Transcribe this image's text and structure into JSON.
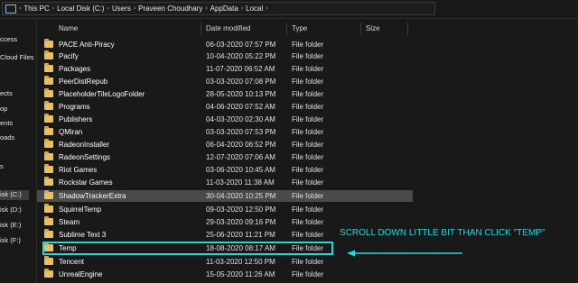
{
  "address": {
    "crumbs": [
      "This PC",
      "Local Disk (C:)",
      "Users",
      "Praveen Choudhary",
      "AppData",
      "Local"
    ]
  },
  "nav": {
    "items": [
      {
        "label": "ccess",
        "selected": false
      },
      {
        "label": "Cloud Files",
        "selected": false
      },
      {
        "label": "ects",
        "selected": false
      },
      {
        "label": "op",
        "selected": false
      },
      {
        "label": "ents",
        "selected": false
      },
      {
        "label": "oads",
        "selected": false
      },
      {
        "label": "s",
        "selected": false
      },
      {
        "label": "isk (C:)",
        "selected": true
      },
      {
        "label": "isk (D:)",
        "selected": false
      },
      {
        "label": "isk (E:)",
        "selected": false
      },
      {
        "label": "isk (F:)",
        "selected": false
      }
    ]
  },
  "columns": {
    "name": "Name",
    "date": "Date modified",
    "type": "Type",
    "size": "Size"
  },
  "files": [
    {
      "name": "PACE Anti-Piracy",
      "date": "06-03-2020 07:57 PM",
      "type": "File folder"
    },
    {
      "name": "Pacify",
      "date": "10-04-2020 05:22 PM",
      "type": "File folder"
    },
    {
      "name": "Packages",
      "date": "11-07-2020 06:52 AM",
      "type": "File folder"
    },
    {
      "name": "PeerDistRepub",
      "date": "03-03-2020 07:08 PM",
      "type": "File folder"
    },
    {
      "name": "PlaceholderTileLogoFolder",
      "date": "28-05-2020 10:13 PM",
      "type": "File folder"
    },
    {
      "name": "Programs",
      "date": "04-06-2020 07:52 AM",
      "type": "File folder"
    },
    {
      "name": "Publishers",
      "date": "04-03-2020 02:30 AM",
      "type": "File folder"
    },
    {
      "name": "QMiran",
      "date": "03-03-2020 07:53 PM",
      "type": "File folder"
    },
    {
      "name": "RadeonInstaller",
      "date": "06-04-2020 06:52 PM",
      "type": "File folder"
    },
    {
      "name": "RadeonSettings",
      "date": "12-07-2020 07:06 AM",
      "type": "File folder"
    },
    {
      "name": "Riot Games",
      "date": "03-06-2020 10:45 AM",
      "type": "File folder"
    },
    {
      "name": "Rockstar Games",
      "date": "11-03-2020 11:38 AM",
      "type": "File folder"
    },
    {
      "name": "ShadowTrackerExtra",
      "date": "30-04-2020 10:25 PM",
      "type": "File folder",
      "highlight": true
    },
    {
      "name": "SquirrelTemp",
      "date": "09-03-2020 12:50 PM",
      "type": "File folder"
    },
    {
      "name": "Steam",
      "date": "29-03-2020 09:16 PM",
      "type": "File folder"
    },
    {
      "name": "Sublime Text 3",
      "date": "25-06-2020 11:21 PM",
      "type": "File folder"
    },
    {
      "name": "Temp",
      "date": "18-08-2020 08:17 AM",
      "type": "File folder"
    },
    {
      "name": "Tencent",
      "date": "11-03-2020 12:50 PM",
      "type": "File folder"
    },
    {
      "name": "UnrealEngine",
      "date": "15-05-2020 11:26 AM",
      "type": "File folder"
    }
  ],
  "annotation": {
    "text": "SCROLL DOWN LITTLE BIT THAN CLICK \"TEMP\"",
    "color": "#2bd5d8"
  },
  "colors": {
    "background": "#191919",
    "folder": "#e8c06a",
    "row_highlight": "#4a4a4a",
    "callout": "#2bd5d8"
  },
  "icons": {
    "crumb_separator": "chevron-right-icon",
    "address_root": "this-pc-icon",
    "folder": "folder-icon"
  }
}
